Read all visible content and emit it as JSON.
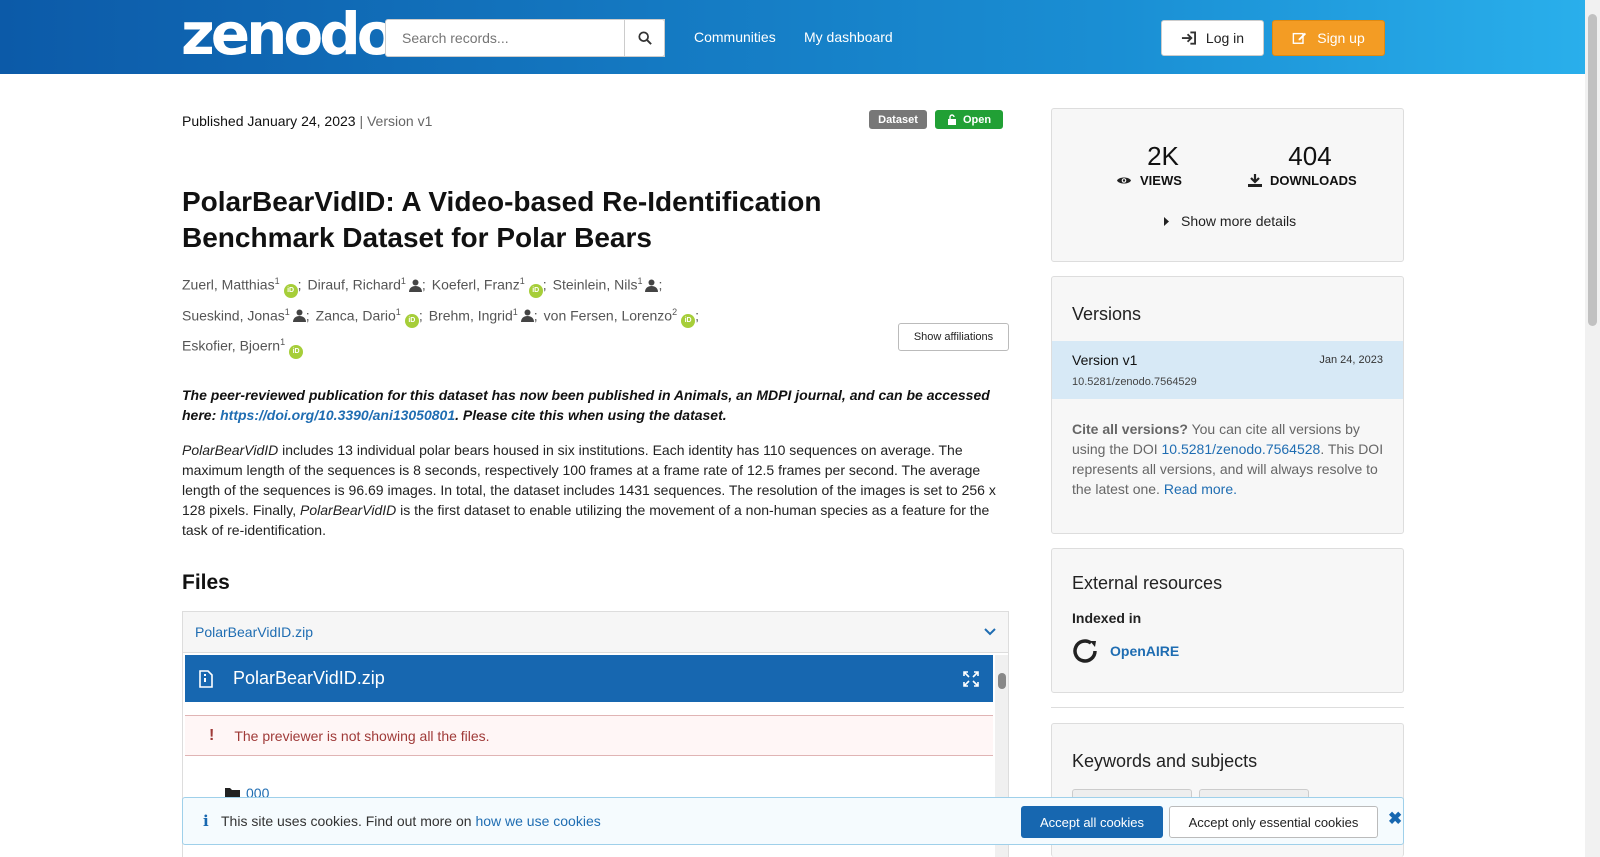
{
  "header": {
    "logo": "zenodo",
    "search_placeholder": "Search records...",
    "nav": [
      "Communities",
      "My dashboard"
    ],
    "login": "Log in",
    "signup": "Sign up"
  },
  "record": {
    "published": "Published January 24, 2023",
    "version_sep": " | Version v1",
    "badge_type": "Dataset",
    "badge_access": "Open",
    "title": "PolarBearVidID: A Video-based Re-Identification Benchmark Dataset for Polar Bears",
    "authors": [
      {
        "name": "Zuerl, Matthias",
        "aff": "1",
        "id": "orcid"
      },
      {
        "name": "Dirauf, Richard",
        "aff": "1",
        "id": "person"
      },
      {
        "name": "Koeferl, Franz",
        "aff": "1",
        "id": "orcid"
      },
      {
        "name": "Steinlein, Nils",
        "aff": "1",
        "id": "person"
      },
      {
        "name": "Sueskind, Jonas",
        "aff": "1",
        "id": "person"
      },
      {
        "name": "Zanca, Dario",
        "aff": "1",
        "id": "orcid"
      },
      {
        "name": "Brehm, Ingrid",
        "aff": "1",
        "id": "person"
      },
      {
        "name": "von Fersen, Lorenzo",
        "aff": "2",
        "id": "orcid"
      },
      {
        "name": "Eskofier, Bjoern",
        "aff": "1",
        "id": "orcid"
      }
    ],
    "show_affiliations": "Show affiliations",
    "notice_pre": "The peer-reviewed publication for this dataset has now been published in Animals, an MDPI journal, and can be accessed here: ",
    "notice_link": "https://doi.org/10.3390/ani13050801",
    "notice_post": ". Please cite this when using the dataset.",
    "desc_em": "PolarBearVidID",
    "desc_1": " includes 13 individual polar bears housed in six institutions. Each identity has 110 sequences on average. The maximum length of the sequences is 8 seconds, respectively 100 frames at a frame rate of 12.5 frames per second. The average length of the sequences is 96.69 images. In total, the dataset includes 1431 sequences. The resolution of the images is set to 256 x 128 pixels. Finally, ",
    "desc_em2": "PolarBearVidID",
    "desc_2": " is the first dataset to enable utilizing the movement of a non-human species as a feature for the task of re-identification."
  },
  "files": {
    "heading": "Files",
    "accordion_label": "PolarBearVidID.zip",
    "preview_name": "PolarBearVidID.zip",
    "warning": "The previewer is not showing all the files.",
    "folder": "000"
  },
  "stats": {
    "views": "2K",
    "views_label": "VIEWS",
    "downloads": "404",
    "downloads_label": "DOWNLOADS",
    "more": "Show more details"
  },
  "versions": {
    "heading": "Versions",
    "current_label": "Version v1",
    "current_date": "Jan 24, 2023",
    "current_doi": "10.5281/zenodo.7564529",
    "cite_bold": "Cite all versions?",
    "cite_1": " You can cite all versions by using the DOI ",
    "cite_doi": "10.5281/zenodo.7564528",
    "cite_2": ". This DOI represents all versions, and will always resolve to the latest one. ",
    "read_more": "Read more."
  },
  "external": {
    "heading": "External resources",
    "indexed": "Indexed in",
    "openaire": "OpenAIRE"
  },
  "keywords": {
    "heading": "Keywords and subjects"
  },
  "cookie": {
    "text": "This site uses cookies. Find out more on ",
    "link": "how we use cookies",
    "accept_all": "Accept all cookies",
    "accept_essential": "Accept only essential cookies"
  },
  "colors": {
    "accent": "#1767b0",
    "signup": "#f39c24",
    "open": "#21a035"
  }
}
